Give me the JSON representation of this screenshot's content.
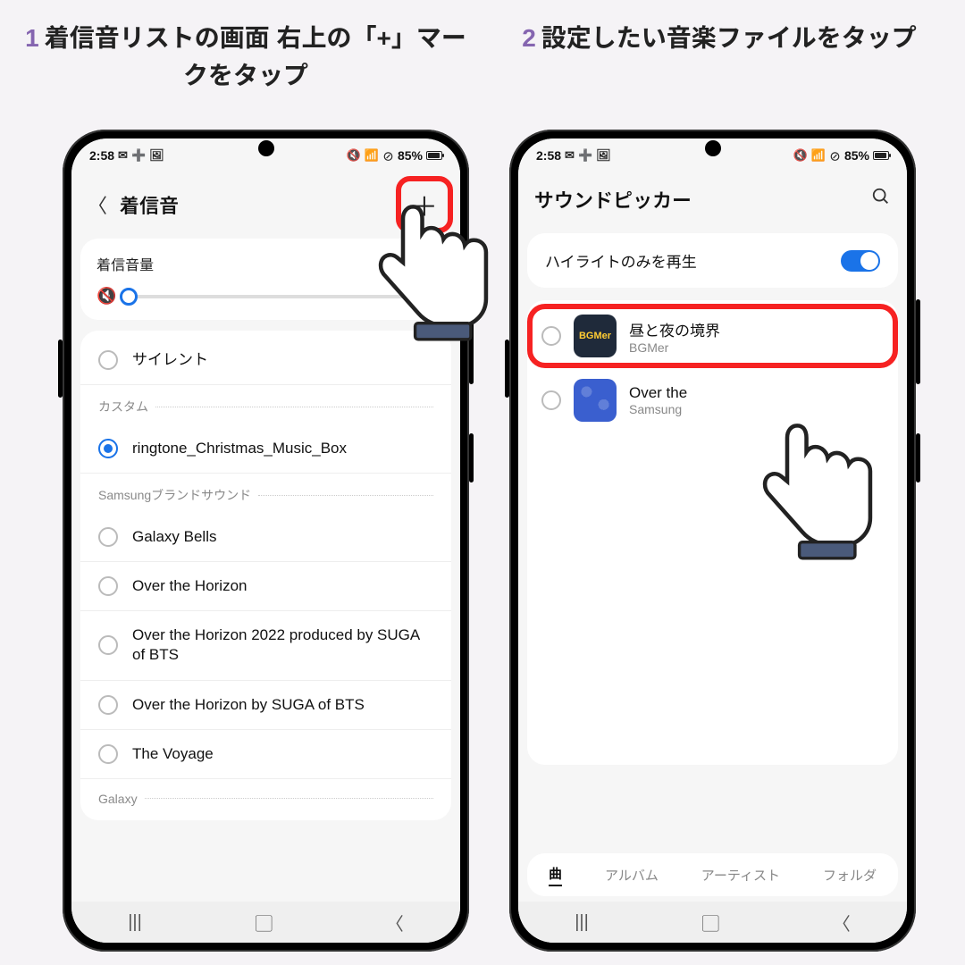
{
  "captions": {
    "one_num": "1",
    "one_text": "着信音リストの画面 右上の「+」マークをタップ",
    "two_num": "2",
    "two_text": "設定したい音楽ファイルをタップ"
  },
  "status": {
    "time": "2:58",
    "battery": "85%"
  },
  "left": {
    "title": "着信音",
    "volume_label": "着信音量",
    "items": {
      "silent": "サイレント",
      "custom_header": "カスタム",
      "custom_ringtone": "ringtone_Christmas_Music_Box",
      "samsung_header": "Samsungブランドサウンド",
      "s0": "Galaxy Bells",
      "s1": "Over the Horizon",
      "s2": "Over the Horizon 2022 produced by SUGA of BTS",
      "s3": "Over the Horizon by SUGA of BTS",
      "s4": "The Voyage",
      "galaxy_header": "Galaxy"
    }
  },
  "right": {
    "title": "サウンドピッカー",
    "highlight_label": "ハイライトのみを再生",
    "songs": {
      "song1_title": "昼と夜の境界",
      "song1_sub": "BGMer",
      "song1_cover": "BGMer",
      "song2_title": "Over the",
      "song2_sub": "Samsung"
    },
    "tabs": {
      "t1": "曲",
      "t2": "アルバム",
      "t3": "アーティスト",
      "t4": "フォルダ"
    }
  }
}
